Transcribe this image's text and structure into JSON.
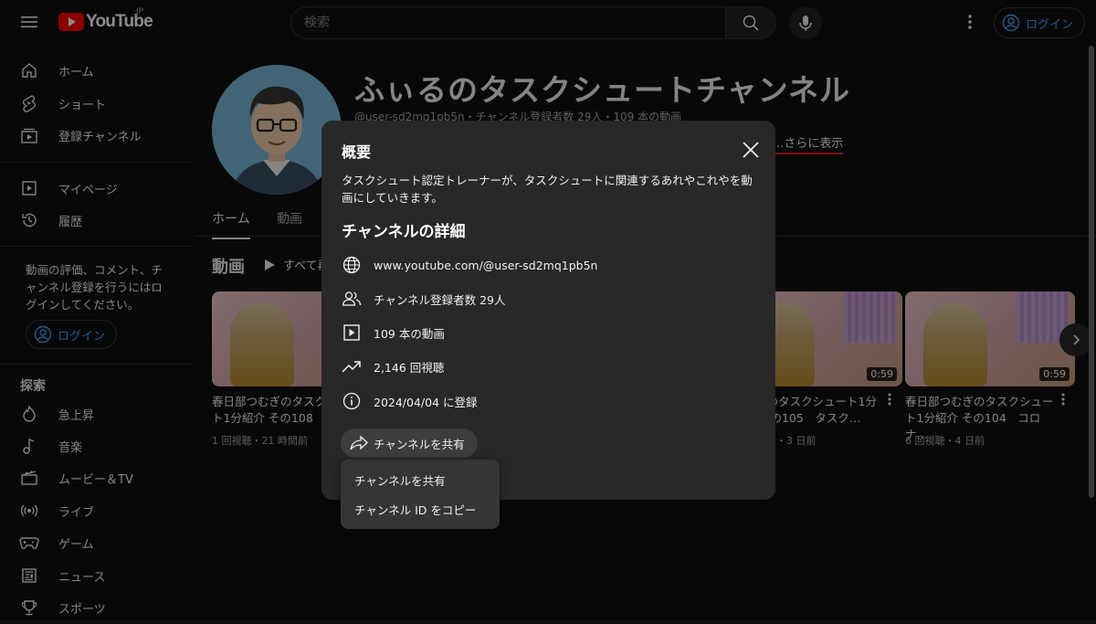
{
  "header": {
    "logo_text": "YouTube",
    "region": "JP",
    "search_placeholder": "検索",
    "login_label": "ログイン"
  },
  "sidebar": {
    "items_top": [
      {
        "label": "ホーム",
        "icon": "home-icon"
      },
      {
        "label": "ショート",
        "icon": "shorts-icon"
      },
      {
        "label": "登録チャンネル",
        "icon": "subscriptions-icon"
      }
    ],
    "items_mid": [
      {
        "label": "マイページ",
        "icon": "my-page-icon"
      },
      {
        "label": "履歴",
        "icon": "history-icon"
      }
    ],
    "signin_note": "動画の評価、コメント、チャンネル登録を行うにはログインしてください。",
    "login_label": "ログイン",
    "explore_title": "探索",
    "explore_items": [
      {
        "label": "急上昇",
        "icon": "trending-icon"
      },
      {
        "label": "音楽",
        "icon": "music-icon"
      },
      {
        "label": "ムービー＆TV",
        "icon": "movies-icon"
      },
      {
        "label": "ライブ",
        "icon": "live-icon"
      },
      {
        "label": "ゲーム",
        "icon": "gaming-icon"
      },
      {
        "label": "ニュース",
        "icon": "news-icon"
      },
      {
        "label": "スポーツ",
        "icon": "sports-icon"
      }
    ]
  },
  "channel": {
    "name": "ふぃるのタスクシュートチャンネル",
    "meta": "@user-sd2mq1pb5n・チャンネル登録者数 29人・109 本の動画",
    "more_link": "...さらに表示",
    "tabs": [
      "ホーム",
      "動画"
    ],
    "section_title": "動画",
    "play_all": "すべて再"
  },
  "videos": [
    {
      "title": "春日部つむぎのタスクシュート1分紹介 その108",
      "meta": "1 回視聴・21 時間前",
      "duration": ""
    },
    {
      "title": "つむぎのタスクシュート1分紹介 その105　タスク…",
      "meta": "・3 日前",
      "duration": "0:59"
    },
    {
      "title": "春日部つむぎのタスクシュート1分紹介 その104　コロナ…",
      "meta": "6 回視聴・4 日前",
      "duration": "0:59"
    }
  ],
  "dialog": {
    "title": "概要",
    "description": "タスクシュート認定トレーナーが、タスクシュートに関連するあれやこれやを動画にしていきます。",
    "details_title": "チャンネルの詳細",
    "details": [
      {
        "icon": "globe-icon",
        "text": "www.youtube.com/@user-sd2mq1pb5n"
      },
      {
        "icon": "subscribers-icon",
        "text": "チャンネル登録者数 29人"
      },
      {
        "icon": "video-icon",
        "text": "109 本の動画"
      },
      {
        "icon": "trending-up-icon",
        "text": "2,146 回視聴"
      },
      {
        "icon": "info-icon",
        "text": "2024/04/04 に登録"
      }
    ],
    "share_label": "チャンネルを共有",
    "share_menu": [
      "チャンネルを共有",
      "チャンネル ID をコピー"
    ]
  },
  "colors": {
    "background": "#0f0f0f",
    "dialog": "#282828",
    "accent_blue": "#3ea6ff",
    "brand_red": "#ff0000"
  }
}
